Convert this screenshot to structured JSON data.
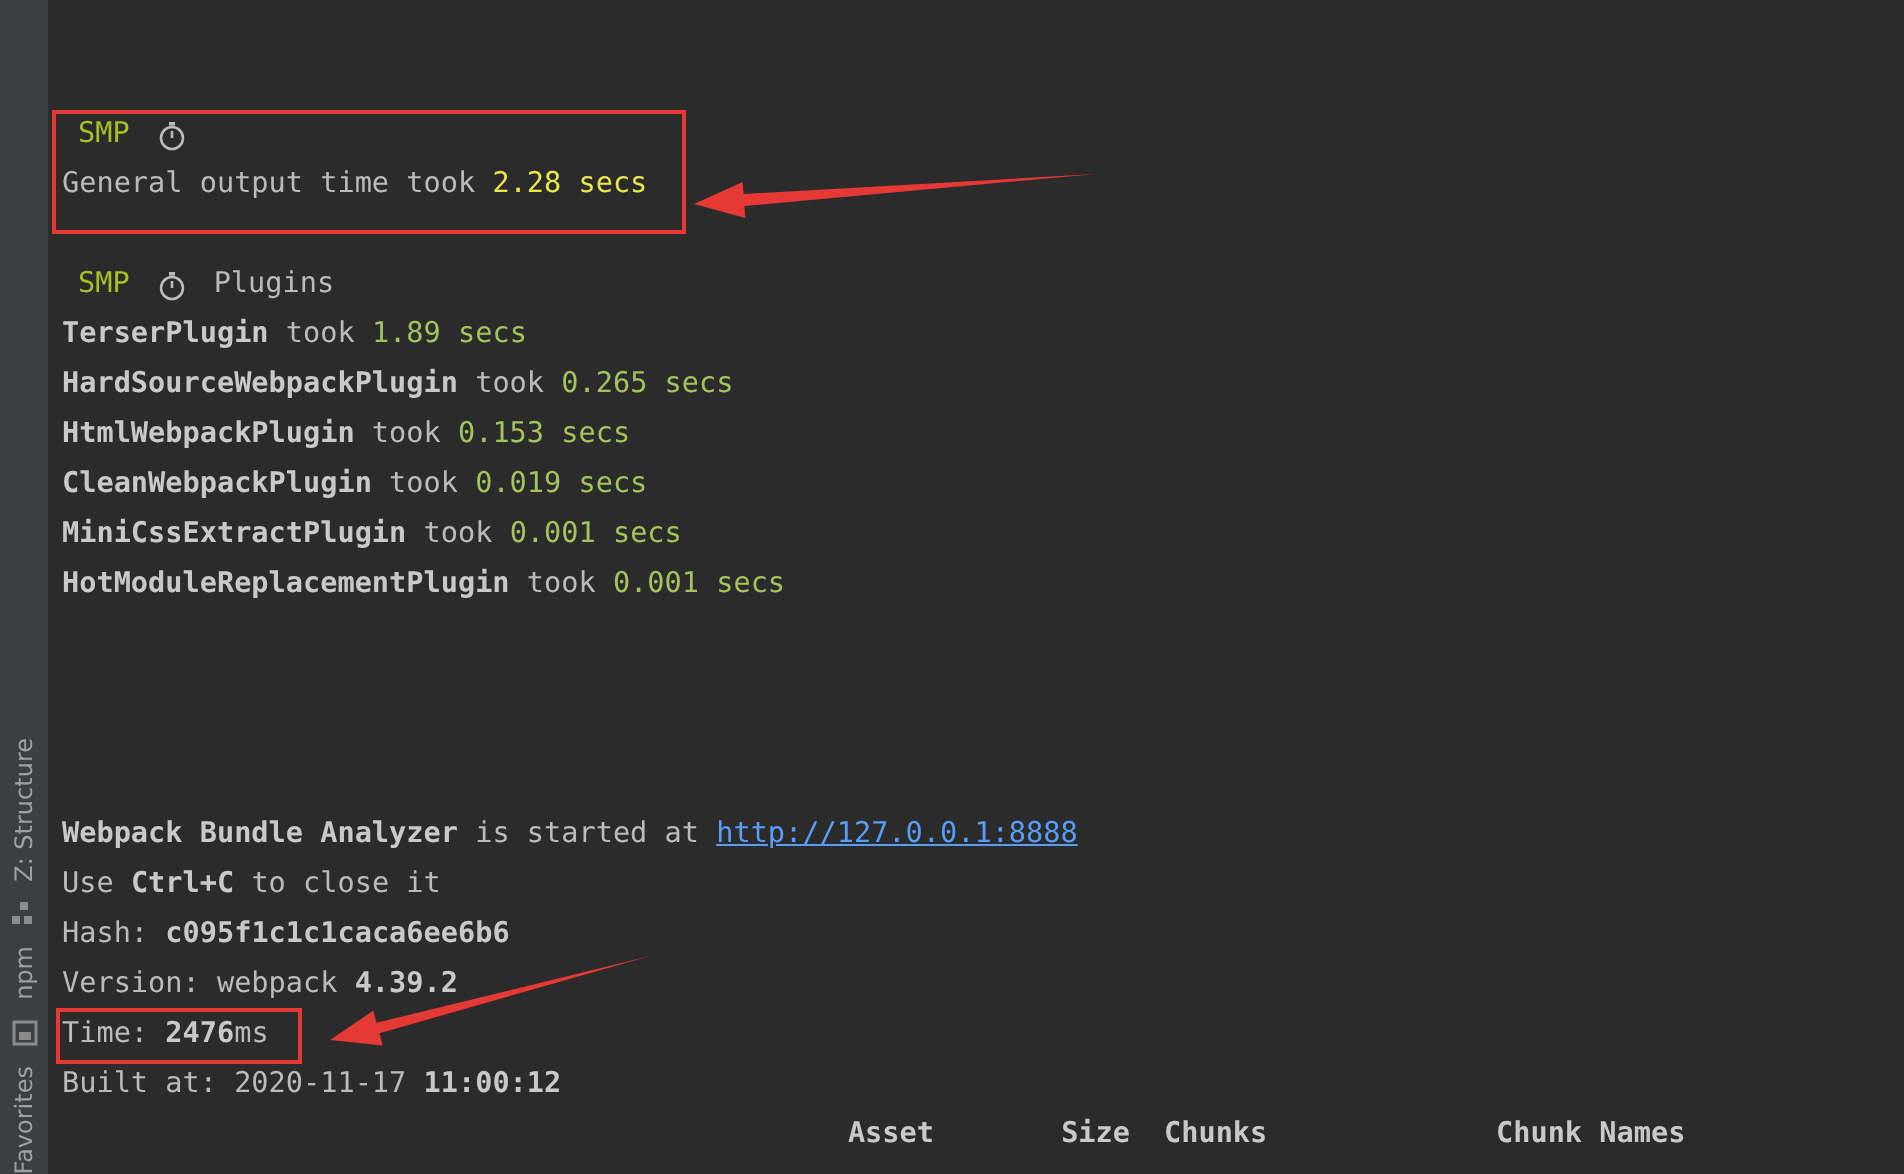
{
  "sidebar": {
    "tabs": [
      {
        "label": "Z: Structure"
      },
      {
        "label": "npm"
      },
      {
        "label": "Favorites"
      }
    ]
  },
  "console": {
    "lines": [
      {
        "kind": "text",
        "segments": [
          {
            "kind": "tag",
            "text": "SMP"
          },
          {
            "kind": "icon"
          }
        ]
      },
      {
        "kind": "text",
        "segments": [
          {
            "kind": "plain",
            "text": "General output time took "
          },
          {
            "kind": "highlight",
            "text": "2.28 secs"
          }
        ]
      },
      {
        "kind": "blank"
      },
      {
        "kind": "text",
        "segments": [
          {
            "kind": "tag",
            "text": "SMP"
          },
          {
            "kind": "icon"
          },
          {
            "kind": "plain",
            "text": "Plugins"
          }
        ]
      },
      {
        "kind": "text",
        "segments": [
          {
            "kind": "bold",
            "text": "TerserPlugin"
          },
          {
            "kind": "plain",
            "text": " took "
          },
          {
            "kind": "number",
            "text": "1.89 secs"
          }
        ]
      },
      {
        "kind": "text",
        "segments": [
          {
            "kind": "bold",
            "text": "HardSourceWebpackPlugin"
          },
          {
            "kind": "plain",
            "text": " took "
          },
          {
            "kind": "number",
            "text": "0.265 secs"
          }
        ]
      },
      {
        "kind": "text",
        "segments": [
          {
            "kind": "bold",
            "text": "HtmlWebpackPlugin"
          },
          {
            "kind": "plain",
            "text": " took "
          },
          {
            "kind": "number",
            "text": "0.153 secs"
          }
        ]
      },
      {
        "kind": "text",
        "segments": [
          {
            "kind": "bold",
            "text": "CleanWebpackPlugin"
          },
          {
            "kind": "plain",
            "text": " took "
          },
          {
            "kind": "number",
            "text": "0.019 secs"
          }
        ]
      },
      {
        "kind": "text",
        "segments": [
          {
            "kind": "bold",
            "text": "MiniCssExtractPlugin"
          },
          {
            "kind": "plain",
            "text": " took "
          },
          {
            "kind": "number",
            "text": "0.001 secs"
          }
        ]
      },
      {
        "kind": "text",
        "segments": [
          {
            "kind": "bold",
            "text": "HotModuleReplacementPlugin"
          },
          {
            "kind": "plain",
            "text": " took "
          },
          {
            "kind": "number",
            "text": "0.001 secs"
          }
        ]
      },
      {
        "kind": "blank"
      },
      {
        "kind": "blank"
      },
      {
        "kind": "blank"
      },
      {
        "kind": "blank"
      },
      {
        "kind": "text",
        "segments": [
          {
            "kind": "bold",
            "text": "Webpack Bundle Analyzer"
          },
          {
            "kind": "plain",
            "text": " is started at "
          },
          {
            "kind": "link",
            "text": "http://127.0.0.1:8888"
          }
        ]
      },
      {
        "kind": "text",
        "segments": [
          {
            "kind": "plain",
            "text": "Use "
          },
          {
            "kind": "bold",
            "text": "Ctrl+C"
          },
          {
            "kind": "plain",
            "text": " to close it"
          }
        ]
      },
      {
        "kind": "text",
        "segments": [
          {
            "kind": "plain",
            "text": "Hash: "
          },
          {
            "kind": "bold",
            "text": "c095f1c1c1caca6ee6b6"
          }
        ]
      },
      {
        "kind": "text",
        "segments": [
          {
            "kind": "plain",
            "text": "Version: webpack "
          },
          {
            "kind": "bold",
            "text": "4.39.2"
          }
        ]
      },
      {
        "kind": "text",
        "segments": [
          {
            "kind": "plain",
            "text": "Time: "
          },
          {
            "kind": "bold",
            "text": "2476"
          },
          {
            "kind": "plain",
            "text": "ms"
          }
        ]
      },
      {
        "kind": "text",
        "segments": [
          {
            "kind": "plain",
            "text": "Built at: 2020-11-17 "
          },
          {
            "kind": "bold",
            "text": "11:00:12"
          }
        ]
      },
      {
        "kind": "columns",
        "cells": [
          "Asset",
          "Size",
          "Chunks",
          "Chunk Names"
        ]
      }
    ]
  }
}
